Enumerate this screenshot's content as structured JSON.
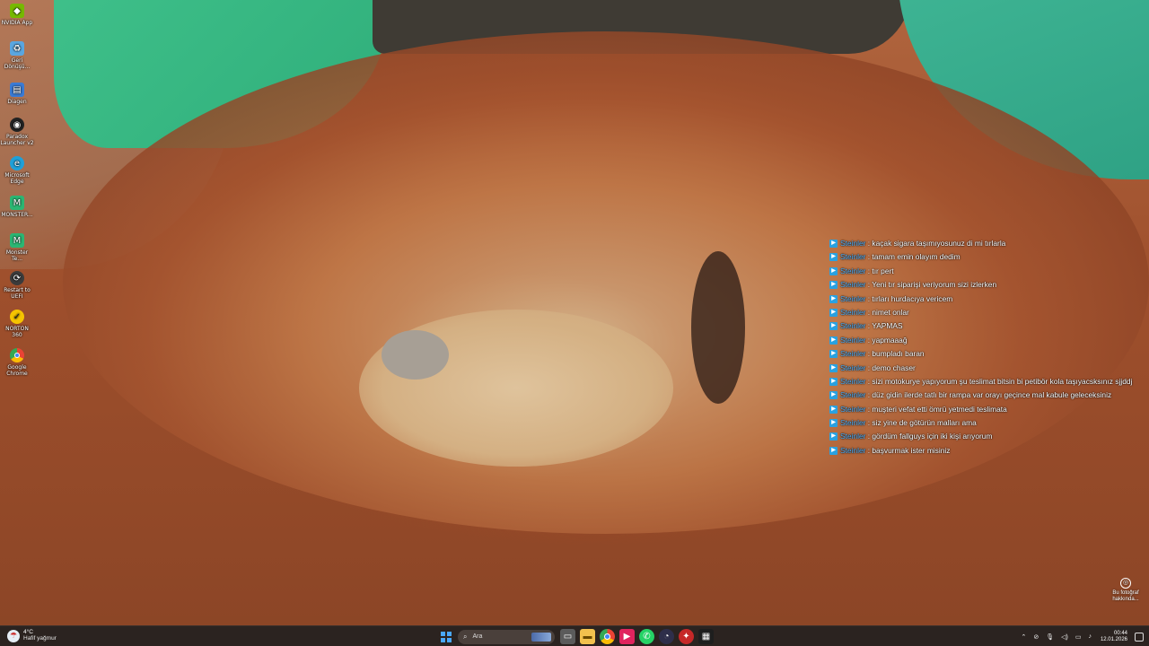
{
  "desktop_icons": [
    {
      "label": "NVIDIA App",
      "icon": "nvidia-icon",
      "color": "#76b900"
    },
    {
      "label": "Geri Dönüşü...",
      "icon": "recycle-bin-icon",
      "color": "#5aa6e0"
    },
    {
      "label": "Diagen",
      "icon": "diagen-icon",
      "color": "#3a7bd5"
    },
    {
      "label": "Paradox Launcher v2",
      "icon": "paradox-icon",
      "color": "#222222"
    },
    {
      "label": "Microsoft Edge",
      "icon": "edge-icon",
      "color": "#1fa0d8"
    },
    {
      "label": "MONSTER...",
      "icon": "monster-icon",
      "color": "#2bb673"
    },
    {
      "label": "Monster Te...",
      "icon": "monster-tech-icon",
      "color": "#2bb673"
    },
    {
      "label": "Restart to UEFI",
      "icon": "uefi-icon",
      "color": "#3b3b3b"
    },
    {
      "label": "NORTON 360",
      "icon": "norton-icon",
      "color": "#f5c400"
    },
    {
      "label": "Google Chrome",
      "icon": "chrome-icon",
      "color": "#ea4335"
    }
  ],
  "chat": {
    "messages": [
      {
        "user": "Steinler",
        "text": "kaçak sigara taşımıyosunuz di mi tırlarla"
      },
      {
        "user": "Steinler",
        "text": "tamam emin olayım dedim"
      },
      {
        "user": "Steinler",
        "text": "tır pert"
      },
      {
        "user": "Steinler",
        "text": "Yeni tır siparişi veriyorum sizi izlerken"
      },
      {
        "user": "Steinler",
        "text": "tırları hurdacıya vericem"
      },
      {
        "user": "Steinler",
        "text": "nimet onlar"
      },
      {
        "user": "Steinler",
        "text": "YAPMAS"
      },
      {
        "user": "Steinler",
        "text": "yapmaaağ"
      },
      {
        "user": "Steinler",
        "text": "bumpladı baran"
      },
      {
        "user": "Steinler",
        "text": "demo chaser"
      },
      {
        "user": "Steinler",
        "text": "sizi motokurye yapıyorum şu teslimat bitsin bi petibör kola taşıyacsksınız sjjddj"
      },
      {
        "user": "Steinler",
        "text": "düz gidin ilerde tatlı bir rampa var orayı geçince mal kabule geleceksiniz"
      },
      {
        "user": "Steinler",
        "text": "muşteri vefat etti ömrü yetmedi teslimata"
      },
      {
        "user": "Steinler",
        "text": "siz yine de götürün malları ama"
      },
      {
        "user": "Steinler",
        "text": "gördüm fallguys için iki kişi arıyorum"
      },
      {
        "user": "Steinler",
        "text": "başvurmak ister misiniz"
      }
    ],
    "separator": ":",
    "user_color": "#4fb3ff"
  },
  "photo_info": {
    "label": "Bu fotoğraf hakkında..."
  },
  "taskbar": {
    "weather": {
      "temp": "4°C",
      "condition": "Hafif yağmur"
    },
    "search_placeholder": "Ara",
    "apps": [
      "task-view-icon",
      "file-explorer-icon",
      "chrome-icon",
      "media-player-icon",
      "whatsapp-icon",
      "obs-icon",
      "vpn-icon",
      "terminal-icon"
    ],
    "clock": {
      "time": "00:44",
      "date": "12.01.2026"
    }
  }
}
